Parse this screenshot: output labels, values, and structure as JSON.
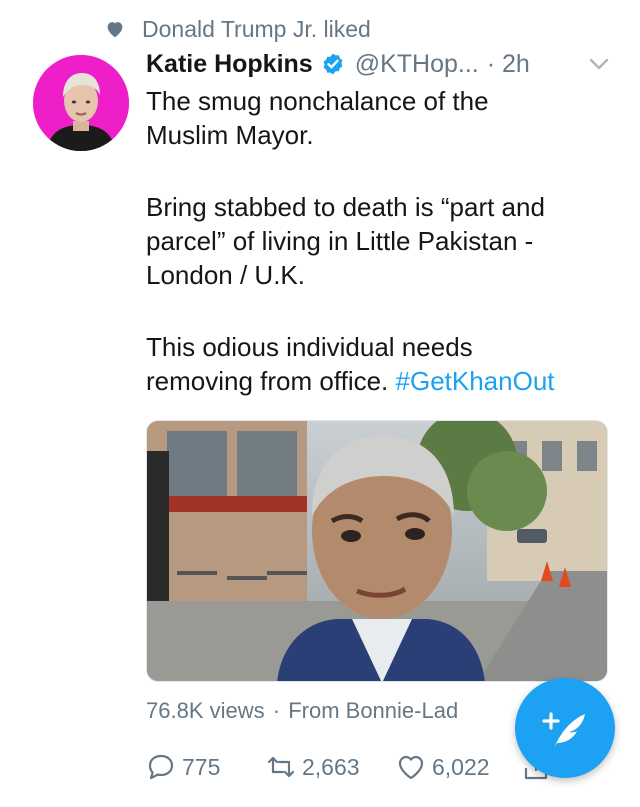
{
  "liked": {
    "text": "Donald Trump Jr. liked",
    "icon": "heart-icon"
  },
  "tweet": {
    "author_name": "Katie Hopkins",
    "handle": "@KTHop...",
    "time": "· 2h",
    "lines": [
      "The smug nonchalance of the",
      "Muslim Mayor.",
      "Bring stabbed to death is “part and",
      "parcel” of living in Little Pakistan -",
      "London / U.K.",
      "This odious individual needs",
      "removing from office. "
    ],
    "hashtag": "#GetKhanOut"
  },
  "media": {
    "views": "76.8K views",
    "separator": "·",
    "source": "From Bonnie-Lad"
  },
  "actions": {
    "replies": "775",
    "retweets": "2,663",
    "likes": "6,022"
  },
  "colors": {
    "accent": "#1da1f2",
    "muted": "#657786",
    "text": "#14171a",
    "avatar_bg": "#ee1fc8"
  }
}
